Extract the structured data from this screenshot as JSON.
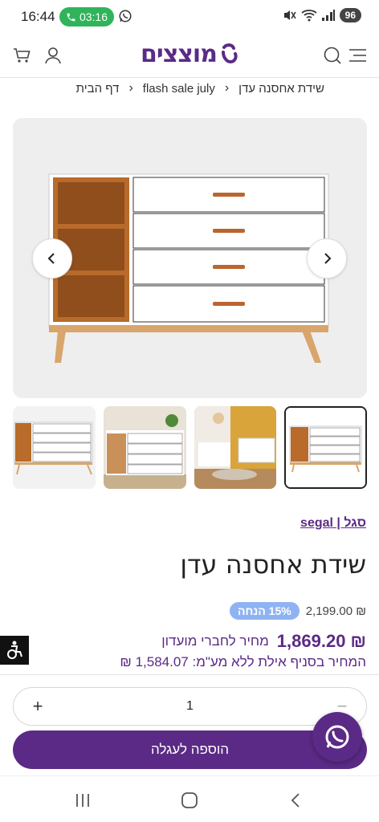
{
  "status_bar": {
    "time": "16:44",
    "call_timer": "03:16",
    "battery": "96"
  },
  "header": {
    "logo_text": "מוצצים",
    "icons": [
      "cart-icon",
      "user-icon",
      "search-icon",
      "menu-icon"
    ],
    "brand_color": "#5b2a86"
  },
  "breadcrumb": {
    "items": [
      "דף הבית",
      "flash sale july",
      "שידת אחסנה עדן"
    ]
  },
  "gallery": {
    "thumbnail_count": 4,
    "active_thumbnail": 4
  },
  "product": {
    "brand": "segal | סגל",
    "title": "שידת אחסנה עדן",
    "old_price": "₪ 2,199.00",
    "discount_badge": "15% הנחה",
    "club_price": "₪ 1,869.20",
    "club_label": "מחיר לחברי מועדון",
    "eilat_price": "המחיר בסניף אילת ללא מע\"מ: 1,584.07 ₪"
  },
  "purchase": {
    "plus": "+",
    "quantity": "1",
    "minus": "−",
    "add_to_cart": "הוספה לעגלה"
  },
  "colors": {
    "accent": "#5b2a86",
    "discount": "#8fb3f2",
    "call_green": "#2fb45a"
  }
}
